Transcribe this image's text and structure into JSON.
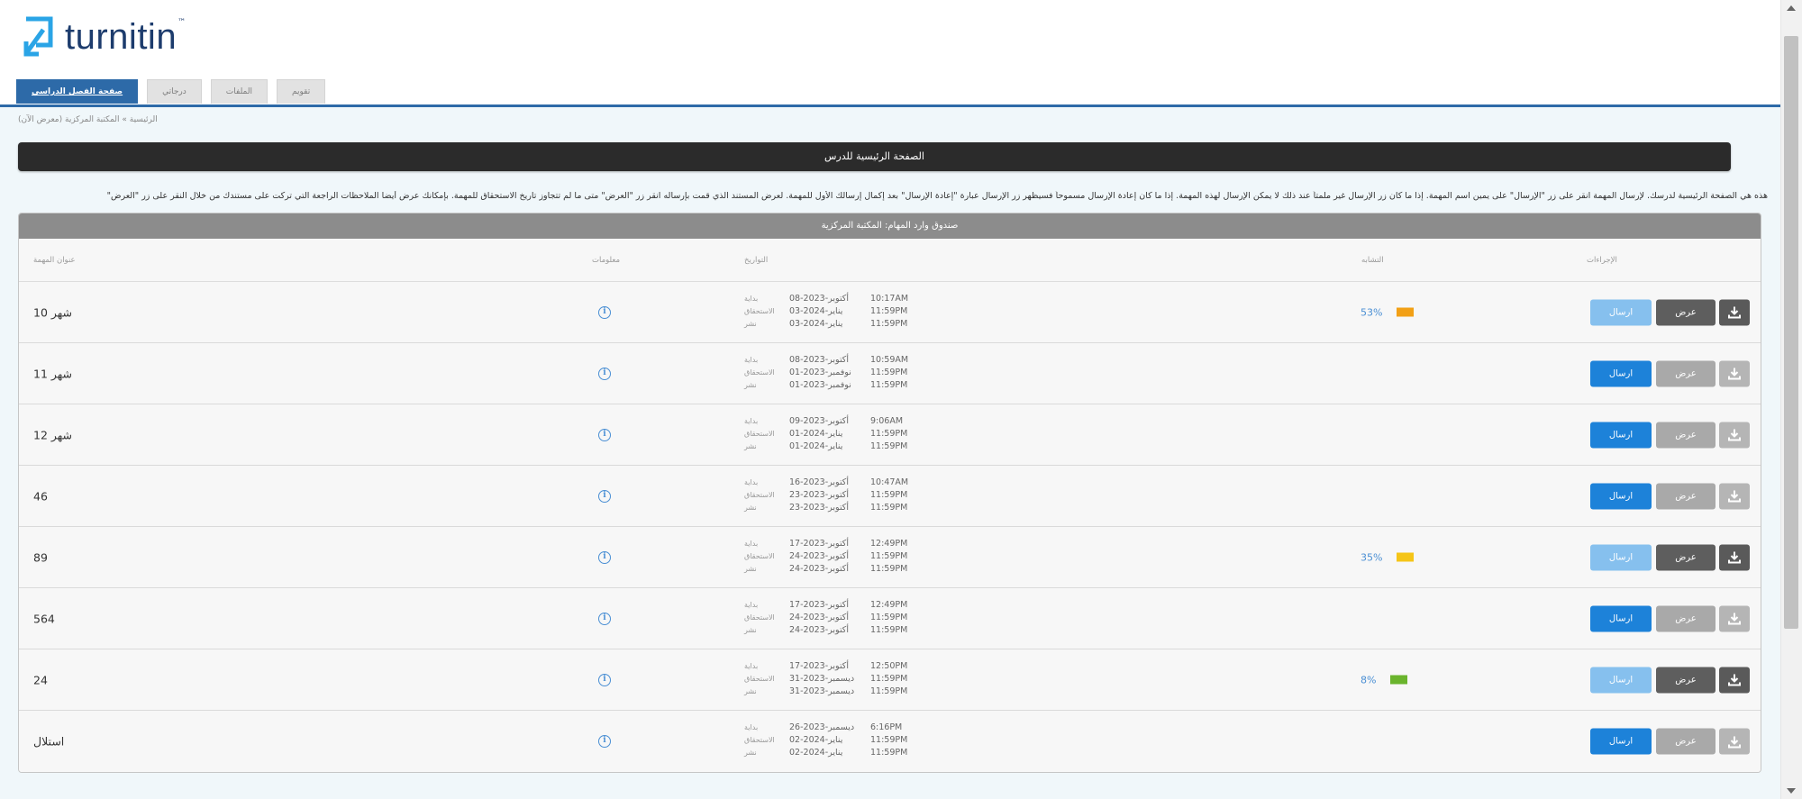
{
  "brand": {
    "name": "turnitin"
  },
  "tabs": [
    {
      "label": "صفحة الفصل الدراسي",
      "active": true
    },
    {
      "label": "درجاتي",
      "active": false
    },
    {
      "label": "الملفات",
      "active": false
    },
    {
      "label": "تقويم",
      "active": false
    }
  ],
  "breadcrumb": "الرئيسية » المكتبة المركزية (معرض الآن)",
  "page_title": "الصفحة الرئيسية للدرس",
  "instructions": "هذه هي الصفحة الرئيسية لدرسك. لإرسال المهمة انقر على زر \"الإرسال\" على يمين اسم المهمة. إذا ما كان زر الإرسال غير ملمتاً عند ذلك لا يمكن الإرسال لهذه المهمة. إذا ما كان إعادة الإرسال مسموحاً فسيظهر زر الإرسال عبارة \"إعادة الإرسال\" بعد إكمال إرسالك الأول للمهمة. لعرض المستند الذي قمت بإرساله انقر زر \"العرض\" متى ما لم تتجاوز تاريخ الاستحقاق للمهمة. بإمكانك عرض أيضا الملاحظات الراجعة التي تركت على مستندك من خلال النقر على زر \"العرض\"",
  "panel": {
    "header": "صندوق وارد المهام: المكتبة المركزية",
    "columns": {
      "title": "عنوان المهمة",
      "info": "معلومات",
      "dates": "التواريخ",
      "similarity": "التشابه",
      "actions": "الإجراءات"
    },
    "labels": {
      "start": "بداية",
      "due": "الاستحقاق",
      "post": "نشر"
    },
    "buttons": {
      "submit": "ارسال",
      "view": "عرض"
    },
    "rows": [
      {
        "title": "شهر 10",
        "start_date": "08-أكتوبر-2023",
        "start_time": "10:17AM",
        "due_date": "03-يناير-2024",
        "due_time": "11:59PM",
        "post_date": "03-يناير-2024",
        "post_time": "11:59PM",
        "similarity": "53%",
        "sim_color": "#f2a016",
        "submit_enabled": false,
        "view_enabled": true,
        "download_enabled": true
      },
      {
        "title": "شهر 11",
        "start_date": "08-أكتوبر-2023",
        "start_time": "10:59AM",
        "due_date": "01-نوفمبر-2023",
        "due_time": "11:59PM",
        "post_date": "01-نوفمبر-2023",
        "post_time": "11:59PM",
        "similarity": "",
        "sim_color": "",
        "submit_enabled": true,
        "view_enabled": false,
        "download_enabled": false
      },
      {
        "title": "شهر 12",
        "start_date": "09-أكتوبر-2023",
        "start_time": "9:06AM",
        "due_date": "01-يناير-2024",
        "due_time": "11:59PM",
        "post_date": "01-يناير-2024",
        "post_time": "11:59PM",
        "similarity": "",
        "sim_color": "",
        "submit_enabled": true,
        "view_enabled": false,
        "download_enabled": false
      },
      {
        "title": "46",
        "start_date": "16-أكتوبر-2023",
        "start_time": "10:47AM",
        "due_date": "23-أكتوبر-2023",
        "due_time": "11:59PM",
        "post_date": "23-أكتوبر-2023",
        "post_time": "11:59PM",
        "similarity": "",
        "sim_color": "",
        "submit_enabled": true,
        "view_enabled": false,
        "download_enabled": false
      },
      {
        "title": "89",
        "start_date": "17-أكتوبر-2023",
        "start_time": "12:49PM",
        "due_date": "24-أكتوبر-2023",
        "due_time": "11:59PM",
        "post_date": "24-أكتوبر-2023",
        "post_time": "11:59PM",
        "similarity": "35%",
        "sim_color": "#f5c518",
        "submit_enabled": false,
        "view_enabled": true,
        "download_enabled": true
      },
      {
        "title": "564",
        "start_date": "17-أكتوبر-2023",
        "start_time": "12:49PM",
        "due_date": "24-أكتوبر-2023",
        "due_time": "11:59PM",
        "post_date": "24-أكتوبر-2023",
        "post_time": "11:59PM",
        "similarity": "",
        "sim_color": "",
        "submit_enabled": true,
        "view_enabled": false,
        "download_enabled": false
      },
      {
        "title": "24",
        "start_date": "17-أكتوبر-2023",
        "start_time": "12:50PM",
        "due_date": "31-ديسمبر-2023",
        "due_time": "11:59PM",
        "post_date": "31-ديسمبر-2023",
        "post_time": "11:59PM",
        "similarity": "8%",
        "sim_color": "#6ab42d",
        "submit_enabled": false,
        "view_enabled": true,
        "download_enabled": true
      },
      {
        "title": "استلال",
        "start_date": "26-ديسمبر-2023",
        "start_time": "6:16PM",
        "due_date": "02-يناير-2024",
        "due_time": "11:59PM",
        "post_date": "02-يناير-2024",
        "post_time": "11:59PM",
        "similarity": "",
        "sim_color": "",
        "submit_enabled": true,
        "view_enabled": false,
        "download_enabled": false
      }
    ]
  }
}
